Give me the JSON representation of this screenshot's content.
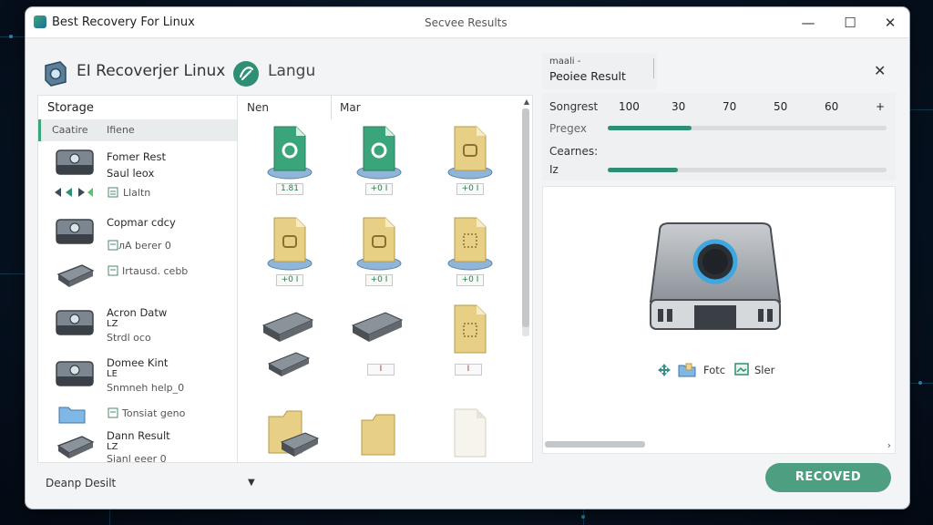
{
  "window": {
    "app_title": "Best Recovery For Linux",
    "center_title": "Secvee Results",
    "controls": {
      "minimize": "—",
      "maximize": "☐",
      "close": "✕"
    }
  },
  "header": {
    "brand": "ЕI Recoverjer Linux",
    "language": "Langu"
  },
  "storage": {
    "heading": "Storage",
    "tabs": [
      "Caatire",
      "Ifiene"
    ],
    "items": [
      {
        "line1": "Fomer Rest",
        "line2": "Saul leox",
        "sub": "Llaltn"
      },
      {
        "line1": "Copmar cdcy",
        "line2": "",
        "sub": "лА berer 0"
      },
      {
        "line1": "",
        "line2": "",
        "sub": "Irtausd. cebb"
      },
      {
        "line1": "Acron Datw",
        "line2": "LZ",
        "sub": "Strdl oco"
      },
      {
        "line1": "Domee Kint",
        "line2": "LE",
        "sub": "Snmneh help_0"
      },
      {
        "line1": "",
        "line2": "",
        "sub": "Tonsiat geno"
      },
      {
        "line1": "Dann Result",
        "line2": "LZ",
        "sub": "Sianl eeer 0"
      }
    ]
  },
  "grid": {
    "columns": [
      "Nen",
      "Mar"
    ],
    "tags": [
      "1.81",
      "+0 I",
      "+0 I",
      "+0 I",
      "+0 I",
      "+0 I",
      "I",
      "I"
    ]
  },
  "result": {
    "small": "maali -",
    "title": "Peoiee Result",
    "close": "✕",
    "stats": {
      "label1": "Songrest",
      "label2": "Pregex",
      "label3": "Cearnes:",
      "label4": "Iz",
      "numbers": [
        "100",
        "30",
        "70",
        "50",
        "60",
        "+"
      ],
      "progress1": 0.3,
      "progress2": 0.25
    },
    "preview_labels": [
      "Fotc",
      "Sler"
    ]
  },
  "footer": {
    "select_value": "Deanp Desilt",
    "recover_label": "RECOVED"
  },
  "colors": {
    "accent": "#4e9f82",
    "progress": "#2f8f74",
    "file_green": "#3aa57a",
    "file_yellow": "#e8cf86"
  }
}
